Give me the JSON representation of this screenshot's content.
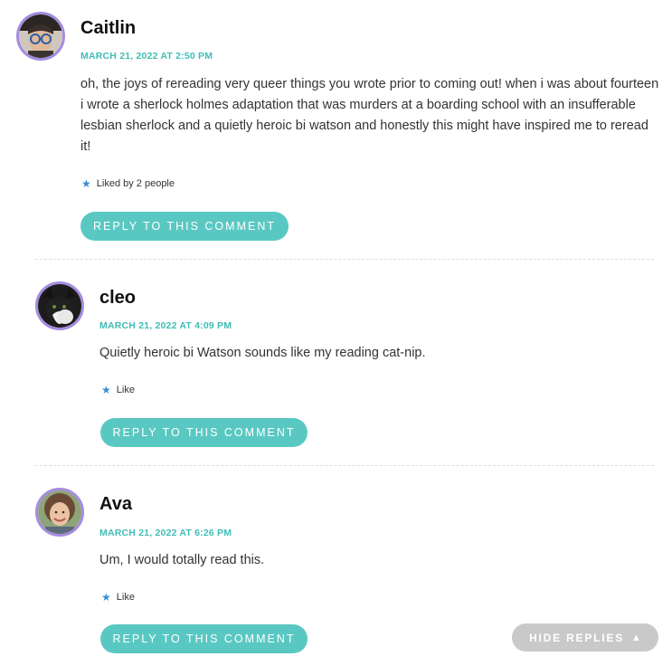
{
  "comments": [
    {
      "author": "Caitlin",
      "date": "MARCH 21, 2022 AT 2:50 PM",
      "text": "oh, the joys of rereading very queer things you wrote prior to coming out! when i was about fourteen i wrote a sherlock holmes adaptation that was murders at a boarding school with an insufferable lesbian sherlock and a quietly heroic bi watson and honestly this might have inspired me to reread it!",
      "like_label": "Liked by 2 people",
      "reply_label": "REPLY TO THIS COMMENT"
    },
    {
      "author": "cleo",
      "date": "MARCH 21, 2022 AT 4:09 PM",
      "text": "Quietly heroic bi Watson sounds like my reading cat-nip.",
      "like_label": "Like",
      "reply_label": "REPLY TO THIS COMMENT"
    },
    {
      "author": "Ava",
      "date": "MARCH 21, 2022 AT 6:26 PM",
      "text": "Um, I would totally read this.",
      "like_label": "Like",
      "reply_label": "REPLY TO THIS COMMENT"
    }
  ],
  "hide_replies": {
    "label": "HIDE REPLIES",
    "icon": "triangle-up-icon"
  },
  "colors": {
    "accent": "#5ac8c2",
    "date": "#3fbdb5",
    "avatar_ring": "#a58ce0",
    "like_star": "#3a8fd6",
    "hide_button": "#c9c9c9"
  }
}
